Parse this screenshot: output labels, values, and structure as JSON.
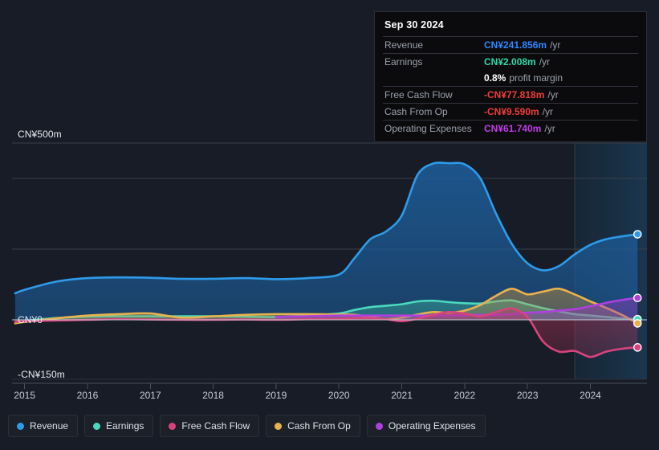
{
  "tooltip": {
    "date": "Sep 30 2024",
    "rows": [
      {
        "key": "Revenue",
        "value": "CN¥241.856m",
        "unit": "/yr",
        "color": "#2e86ff"
      },
      {
        "key": "Earnings",
        "value": "CN¥2.008m",
        "unit": "/yr",
        "color": "#2bd9a8"
      },
      {
        "key": "",
        "value": "0.8%",
        "unit": "profit margin",
        "color": "#ffffff"
      },
      {
        "key": "Free Cash Flow",
        "value": "-CN¥77.818m",
        "unit": "/yr",
        "color": "#ef3b3b"
      },
      {
        "key": "Cash From Op",
        "value": "-CN¥9.590m",
        "unit": "/yr",
        "color": "#ef3b3b"
      },
      {
        "key": "Operating Expenses",
        "value": "CN¥61.740m",
        "unit": "/yr",
        "color": "#c23ae8"
      }
    ]
  },
  "legend": [
    {
      "label": "Revenue",
      "color": "#2e9bea"
    },
    {
      "label": "Earnings",
      "color": "#4ad9be"
    },
    {
      "label": "Free Cash Flow",
      "color": "#d9437d"
    },
    {
      "label": "Cash From Op",
      "color": "#eab14d"
    },
    {
      "label": "Operating Expenses",
      "color": "#b13fe0"
    }
  ],
  "axis": {
    "y_labels": [
      {
        "text": "CN¥500m",
        "value": 500
      },
      {
        "text": "CN¥0",
        "value": 0
      },
      {
        "text": "-CN¥150m",
        "value": -150
      }
    ],
    "x_labels": [
      "2015",
      "2016",
      "2017",
      "2018",
      "2019",
      "2020",
      "2021",
      "2022",
      "2023",
      "2024"
    ]
  },
  "chart_data": {
    "type": "area",
    "title": "",
    "xlabel": "",
    "ylabel": "CN¥",
    "ylim": [
      -150,
      500
    ],
    "xlim": [
      2014.8,
      2024.9
    ],
    "grid": true,
    "legend_position": "bottom",
    "currency": "CN¥",
    "units": "millions",
    "forecast_region_start": 2023.75,
    "x": [
      2014.85,
      2015.0,
      2015.5,
      2016.0,
      2016.5,
      2017.0,
      2017.5,
      2018.0,
      2018.5,
      2019.0,
      2019.5,
      2020.0,
      2020.25,
      2020.5,
      2020.75,
      2021.0,
      2021.25,
      2021.5,
      2021.75,
      2022.0,
      2022.25,
      2022.5,
      2022.75,
      2023.0,
      2023.25,
      2023.5,
      2023.75,
      2024.0,
      2024.25,
      2024.5,
      2024.75
    ],
    "series": [
      {
        "name": "Revenue",
        "color": "#2e9bea",
        "values": [
          75,
          85,
          108,
          118,
          120,
          119,
          116,
          116,
          118,
          115,
          118,
          128,
          175,
          228,
          250,
          295,
          410,
          442,
          443,
          440,
          400,
          300,
          215,
          160,
          140,
          152,
          185,
          212,
          228,
          236,
          242
        ]
      },
      {
        "name": "Earnings",
        "color": "#4ad9be",
        "values": [
          -7,
          -3,
          5,
          9,
          10,
          10,
          10,
          10,
          9,
          8,
          12,
          18,
          28,
          36,
          40,
          44,
          52,
          54,
          50,
          47,
          46,
          52,
          55,
          44,
          33,
          24,
          16,
          12,
          8,
          4,
          2
        ]
      },
      {
        "name": "Free Cash Flow",
        "color": "#d9437d",
        "values": [
          -6,
          -4,
          -2,
          0,
          2,
          1,
          0,
          0,
          1,
          0,
          2,
          3,
          5,
          5,
          2,
          -4,
          3,
          14,
          22,
          18,
          10,
          22,
          32,
          8,
          -62,
          -90,
          -88,
          -105,
          -90,
          -82,
          -78
        ]
      },
      {
        "name": "Cash From Op",
        "color": "#eab14d",
        "values": [
          -10,
          -6,
          4,
          12,
          16,
          18,
          6,
          10,
          14,
          16,
          16,
          15,
          14,
          8,
          3,
          6,
          15,
          22,
          20,
          26,
          42,
          68,
          88,
          72,
          80,
          88,
          72,
          52,
          34,
          14,
          -10
        ]
      },
      {
        "name": "Operating Expenses",
        "color": "#b13fe0",
        "values": [
          null,
          null,
          null,
          null,
          null,
          null,
          null,
          null,
          null,
          8,
          10,
          12,
          12,
          12,
          12,
          12,
          12,
          12,
          12,
          13,
          14,
          14,
          16,
          20,
          22,
          26,
          30,
          38,
          48,
          56,
          62
        ]
      }
    ]
  }
}
